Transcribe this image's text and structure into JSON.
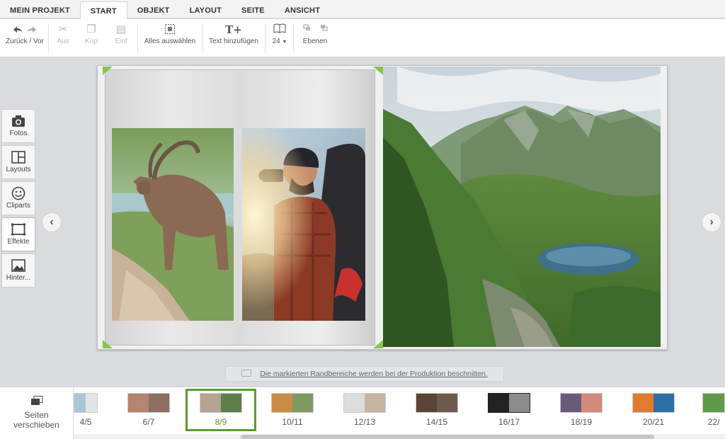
{
  "tabs": [
    {
      "label": "MEIN PROJEKT"
    },
    {
      "label": "START"
    },
    {
      "label": "OBJEKT"
    },
    {
      "label": "LAYOUT"
    },
    {
      "label": "SEITE"
    },
    {
      "label": "ANSICHT"
    }
  ],
  "active_tab": "START",
  "toolbar": {
    "undo_redo_label": "Zurück / Vor",
    "cut_label": "Aus",
    "copy_label": "Kop",
    "paste_label": "Einf",
    "select_all_label": "Alles auswählen",
    "add_text_label": "Text hinzufügen",
    "font_size_value": "24",
    "layers_label": "Ebenen"
  },
  "side_tools": [
    {
      "label": "Fotos",
      "icon": "camera-icon"
    },
    {
      "label": "Layouts",
      "icon": "layouts-icon"
    },
    {
      "label": "Cliparts",
      "icon": "smiley-icon"
    },
    {
      "label": "Effekte",
      "icon": "frame-icon"
    },
    {
      "label": "Hinter...",
      "icon": "background-icon"
    }
  ],
  "info_bar": {
    "text": "Die markierten Randbereiche werden bei der Produktion beschnitten."
  },
  "page_strip": {
    "move_label_line1": "Seiten",
    "move_label_line2": "verschieben",
    "thumbnails": [
      {
        "label": "4/5"
      },
      {
        "label": "6/7"
      },
      {
        "label": "8/9"
      },
      {
        "label": "10/11"
      },
      {
        "label": "12/13"
      },
      {
        "label": "14/15"
      },
      {
        "label": "16/17"
      },
      {
        "label": "18/19"
      },
      {
        "label": "20/21"
      },
      {
        "label": "22/"
      }
    ],
    "selected": "8/9"
  },
  "colors": {
    "accent": "#5e9c2e",
    "corner_marker": "#8bc34a"
  }
}
